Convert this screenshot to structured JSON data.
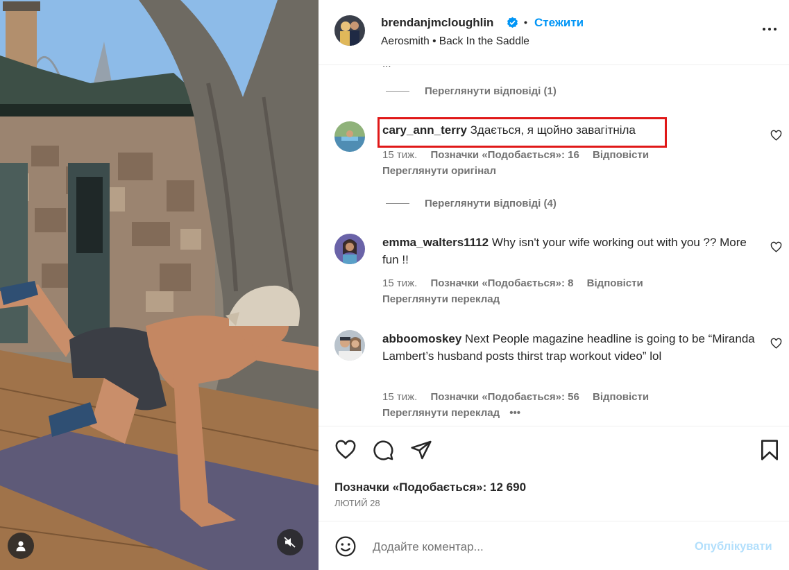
{
  "post": {
    "username": "brendanjmcloughlin",
    "verified_icon": "verified-badge-icon",
    "separator": "•",
    "follow_label": "Стежити",
    "audio": "Aerosmith • Back In the Saddle"
  },
  "comments": {
    "partial_text": "...",
    "replies_1": "Переглянути відповіді (1)",
    "items": [
      {
        "username": "cary_ann_terry",
        "text": "Здається, я щойно завагітніла",
        "time": "15 тиж.",
        "likes": "Позначки «Подобається»: 16",
        "reply": "Відповісти",
        "extra": "Переглянути оригінал",
        "replies": "Переглянути відповіді (4)"
      },
      {
        "username": "emma_walters1112",
        "text": "Why isn't your wife working out with you ?? More fun !!",
        "time": "15 тиж.",
        "likes": "Позначки «Подобається»: 8",
        "reply": "Відповісти",
        "extra": "Переглянути переклад"
      },
      {
        "username": "abboomoskey",
        "text": "Next People magazine headline is going to be “Miranda Lambert’s husband posts thirst trap workout video” lol",
        "time": "15 тиж.",
        "likes": "Позначки «Подобається»: 56",
        "reply": "Відповісти",
        "extra": "Переглянути переклад",
        "more": "•••"
      }
    ]
  },
  "actions": {
    "like_icon": "heart-icon",
    "comment_icon": "comment-icon",
    "share_icon": "send-icon",
    "save_icon": "bookmark-icon"
  },
  "stats": {
    "likes": "Позначки «Подобається»: 12 690",
    "date": "ЛЮТИЙ 28"
  },
  "composer": {
    "placeholder": "Додайте коментар...",
    "post_label": "Опублікувати"
  },
  "colors": {
    "accent": "#0095f6",
    "highlight": "#e01818",
    "post_disabled": "#b2dffc"
  }
}
